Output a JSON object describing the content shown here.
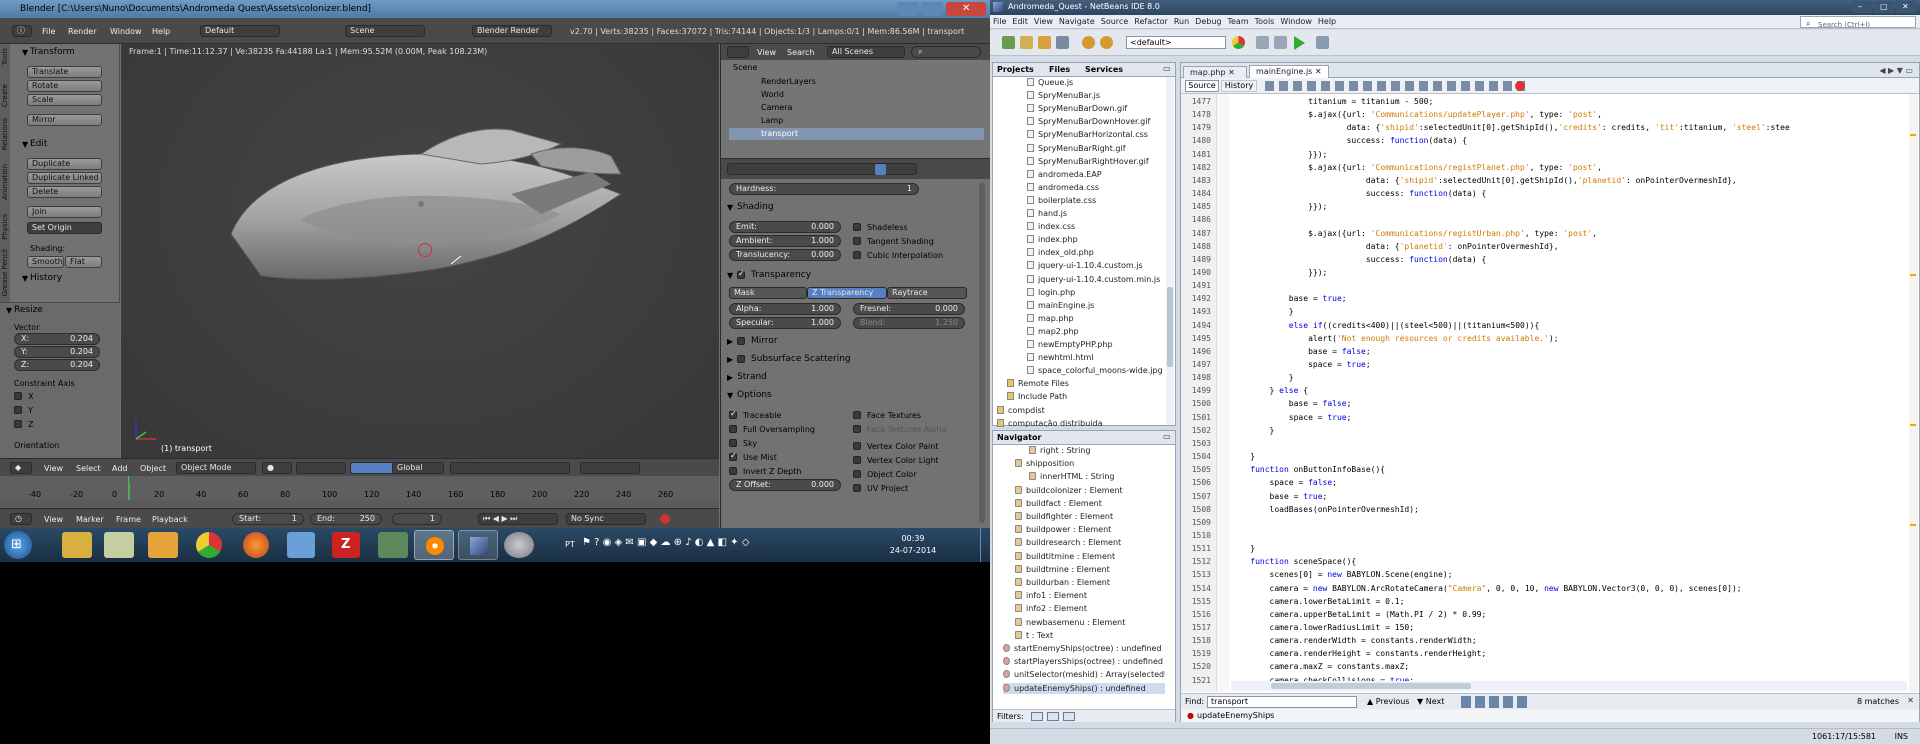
{
  "blender": {
    "title": "Blender [C:\\Users\\Nuno\\Documents\\Andromeda Quest\\Assets\\colonizer.blend]",
    "menu": [
      "File",
      "Render",
      "Window",
      "Help"
    ],
    "layout": "Default",
    "scene": "Scene",
    "engine": "Blender Render",
    "stats": "v2.70 | Verts:38235 | Faces:37072 | Tris:74144 | Objects:1/3 | Lamps:0/1 | Mem:86.56M | transport",
    "viewport_info": "Frame:1 | Time:11:12.37 | Ve:38235 Fa:44188 La:1 | Mem:95.52M (0.00M, Peak 108.23M)",
    "object_label": "(1) transport",
    "side_tabs": [
      "Tools",
      "Create",
      "Relations",
      "Animation",
      "Physics",
      "Grease Pencil"
    ],
    "tool_shelf": {
      "transform_header": "Transform",
      "transform_buttons": [
        "Translate",
        "Rotate",
        "Scale",
        "Mirror"
      ],
      "edit_header": "Edit",
      "edit_buttons": [
        "Duplicate",
        "Duplicate Linked",
        "Delete",
        "Join"
      ],
      "set_origin": "Set Origin",
      "shading_label": "Shading:",
      "smooth": "Smooth",
      "flat": "Flat",
      "history_header": "History",
      "resize_header": "Resize",
      "vector_label": "Vector",
      "vector": [
        {
          "axis": "X:",
          "value": "0.204"
        },
        {
          "axis": "Y:",
          "value": "0.204"
        },
        {
          "axis": "Z:",
          "value": "0.204"
        }
      ],
      "constraint_label": "Constraint Axis",
      "constraint": [
        "X",
        "Y",
        "Z"
      ],
      "orientation_label": "Orientation"
    },
    "viewport_header": {
      "menus": [
        "View",
        "Select",
        "Add",
        "Object"
      ],
      "mode": "Object Mode",
      "orientation": "Global"
    },
    "timeline": {
      "ticks": [
        "-40",
        "-20",
        "0",
        "20",
        "40",
        "60",
        "80",
        "100",
        "120",
        "140",
        "160",
        "180",
        "200",
        "220",
        "240",
        "260"
      ],
      "menus": [
        "View",
        "Marker",
        "Frame",
        "Playback"
      ],
      "start": "Start:",
      "start_val": "1",
      "end": "End:",
      "end_val": "250",
      "current": "1",
      "sync": "No Sync"
    },
    "outliner": {
      "header": [
        "View",
        "Search"
      ],
      "filter": "All Scenes",
      "items": [
        "Scene",
        "RenderLayers",
        "World",
        "Camera",
        "Lamp",
        "transport"
      ]
    },
    "properties": {
      "hardness": "Hardness:",
      "hardness_val": "1",
      "shading_header": "Shading",
      "emit": "Emit:",
      "emit_val": "0.000",
      "ambient": "Ambient:",
      "ambient_val": "1.000",
      "translucency": "Translucency:",
      "translucency_val": "0.000",
      "shadeless": "Shadeless",
      "tangent": "Tangent Shading",
      "cubic": "Cubic Interpolation",
      "transparency_header": "Transparency",
      "mask": "Mask",
      "ztrans": "Z Transparency",
      "raytrace": "Raytrace",
      "alpha": "Alpha:",
      "alpha_val": "1.000",
      "fresnel": "Fresnel:",
      "fresnel_val": "0.000",
      "specular": "Specular:",
      "specular_val": "1.000",
      "blend": "Blend:",
      "blend_val": "1.250",
      "mirror_header": "Mirror",
      "sss_header": "Subsurface Scattering",
      "strand_header": "Strand",
      "options_header": "Options",
      "traceable": "Traceable",
      "full_over": "Full Oversampling",
      "sky": "Sky",
      "use_mist": "Use Mist",
      "invert_z": "Invert Z Depth",
      "zoffset": "Z Offset:",
      "zoffset_val": "0.000",
      "face_textures": "Face Textures",
      "face_textures_alpha": "Face Textures Alpha",
      "vertex_paint": "Vertex Color Paint",
      "vertex_light": "Vertex Color Light",
      "object_color": "Object Color",
      "uv_project": "UV Project"
    }
  },
  "taskbar": {
    "lang": "PT",
    "time": "00:39",
    "date": "24-07-2014"
  },
  "netbeans": {
    "title": "Andromeda_Quest - NetBeans IDE 8.0",
    "menu": [
      "File",
      "Edit",
      "View",
      "Navigate",
      "Source",
      "Refactor",
      "Run",
      "Debug",
      "Team",
      "Tools",
      "Window",
      "Help"
    ],
    "search_placeholder": "Search (Ctrl+I)",
    "config": "<default>",
    "panel_tabs": [
      "Projects",
      "Files",
      "Services"
    ],
    "files": [
      "Queue.js",
      "SpryMenuBar.js",
      "SpryMenuBarDown.gif",
      "SpryMenuBarDownHover.gif",
      "SpryMenuBarHorizontal.css",
      "SpryMenuBarRight.gif",
      "SpryMenuBarRightHover.gif",
      "andromeda.EAP",
      "andromeda.css",
      "boilerplate.css",
      "hand.js",
      "index.css",
      "index.php",
      "index_old.php",
      "jquery-ui-1.10.4.custom.js",
      "jquery-ui-1.10.4.custom.min.js",
      "login.php",
      "mainEngine.js",
      "map.php",
      "map2.php",
      "newEmptyPHP.php",
      "newhtml.html",
      "space_colorful_moons-wide.jpg",
      "Remote Files",
      "Include Path",
      "compdist",
      "computação distribuida"
    ],
    "navigator_title": "Navigator",
    "navigator": [
      "right : String",
      "shipposition",
      "innerHTML : String",
      "buildcolonizer : Element",
      "buildfact : Element",
      "buildfighter : Element",
      "buildpower : Element",
      "buildresearch : Element",
      "buildtitmine : Element",
      "buildtmine : Element",
      "buildurban : Element",
      "info1 : Element",
      "info2 : Element",
      "newbasemenu : Element",
      "t : Text",
      "startEnemyShips(octree) : undefined",
      "startPlayersShips(octree) : undefined",
      "unitSelector(meshid) : Array(selectedUnit,u",
      "updateEnemyShips() : undefined"
    ],
    "filters_label": "Filters:",
    "editor_tabs": [
      "map.php",
      "mainEngine.js"
    ],
    "source_tab": "Source",
    "history_tab": "History",
    "code": [
      {
        "n": "1477",
        "t": "                titanium = titanium - 500;"
      },
      {
        "n": "1478",
        "t": "                $.ajax({url: 'Communications/updatePlayer.php', type: 'post',"
      },
      {
        "n": "1479",
        "t": "                        data: {'shipid':selectedUnit[0].getShipId(),'credits': credits, 'tit':titanium, 'steel':stee"
      },
      {
        "n": "1480",
        "t": "                        success: function(data) {"
      },
      {
        "n": "1481",
        "t": "                }});"
      },
      {
        "n": "1482",
        "t": "                $.ajax({url: 'Communications/registPlanet.php', type: 'post',"
      },
      {
        "n": "1483",
        "t": "                            data: {'shipid':selectedUnit[0].getShipId(),'planetid': onPointerOvermeshId},"
      },
      {
        "n": "1484",
        "t": "                            success: function(data) {"
      },
      {
        "n": "1485",
        "t": "                }});"
      },
      {
        "n": "1486",
        "t": ""
      },
      {
        "n": "1487",
        "t": "                $.ajax({url: 'Communications/registUrban.php', type: 'post',"
      },
      {
        "n": "1488",
        "t": "                            data: {'planetid': onPointerOvermeshId},"
      },
      {
        "n": "1489",
        "t": "                            success: function(data) {"
      },
      {
        "n": "1490",
        "t": "                }});"
      },
      {
        "n": "1491",
        "t": ""
      },
      {
        "n": "1492",
        "t": "            base = true;"
      },
      {
        "n": "1493",
        "t": "            }"
      },
      {
        "n": "1494",
        "t": "            else if((credits<400)||(steel<500)||(titanium<500)){"
      },
      {
        "n": "1495",
        "t": "                alert('Not enough resources or credits available.');"
      },
      {
        "n": "1496",
        "t": "                base = false;"
      },
      {
        "n": "1497",
        "t": "                space = true;"
      },
      {
        "n": "1498",
        "t": "            }"
      },
      {
        "n": "1499",
        "t": "        } else {"
      },
      {
        "n": "1500",
        "t": "            base = false;"
      },
      {
        "n": "1501",
        "t": "            space = true;"
      },
      {
        "n": "1502",
        "t": "        }"
      },
      {
        "n": "1503",
        "t": ""
      },
      {
        "n": "1504",
        "t": "    }"
      },
      {
        "n": "1505",
        "t": "    function onButtonInfoBase(){"
      },
      {
        "n": "1506",
        "t": "        space = false;"
      },
      {
        "n": "1507",
        "t": "        base = true;"
      },
      {
        "n": "1508",
        "t": "        loadBases(onPointerOvermeshId);"
      },
      {
        "n": "1509",
        "t": ""
      },
      {
        "n": "1510",
        "t": ""
      },
      {
        "n": "1511",
        "t": "    }"
      },
      {
        "n": "1512",
        "t": "    function sceneSpace(){"
      },
      {
        "n": "1513",
        "t": "        scenes[0] = new BABYLON.Scene(engine);"
      },
      {
        "n": "1514",
        "t": "        camera = new BABYLON.ArcRotateCamera(\"Camera\", 0, 0, 10, new BABYLON.Vector3(0, 0, 0), scenes[0]);"
      },
      {
        "n": "1515",
        "t": "        camera.lowerBetaLimit = 0.1;"
      },
      {
        "n": "1516",
        "t": "        camera.upperBetaLimit = (Math.PI / 2) * 0.99;"
      },
      {
        "n": "1517",
        "t": "        camera.lowerRadiusLimit = 150;"
      },
      {
        "n": "1518",
        "t": "        camera.renderWidth = constants.renderWidth;"
      },
      {
        "n": "1519",
        "t": "        camera.renderHeight = constants.renderHeight;"
      },
      {
        "n": "1520",
        "t": "        camera.maxZ = constants.maxZ;"
      },
      {
        "n": "1521",
        "t": "        camera.checkCollisions = true;"
      }
    ],
    "find_label": "Find:",
    "find_value": "transport",
    "previous": "Previous",
    "next": "Next",
    "matches": "8 matches",
    "breadcrumb": "updateEnemyShips",
    "status_pos": "1061:17/15:581",
    "status_ins": "INS"
  },
  "colors": {
    "blender_bg": "#727272",
    "viewport": "#393939",
    "nb_bg": "#d4dbe5",
    "accent_blue": "#5680c2"
  }
}
